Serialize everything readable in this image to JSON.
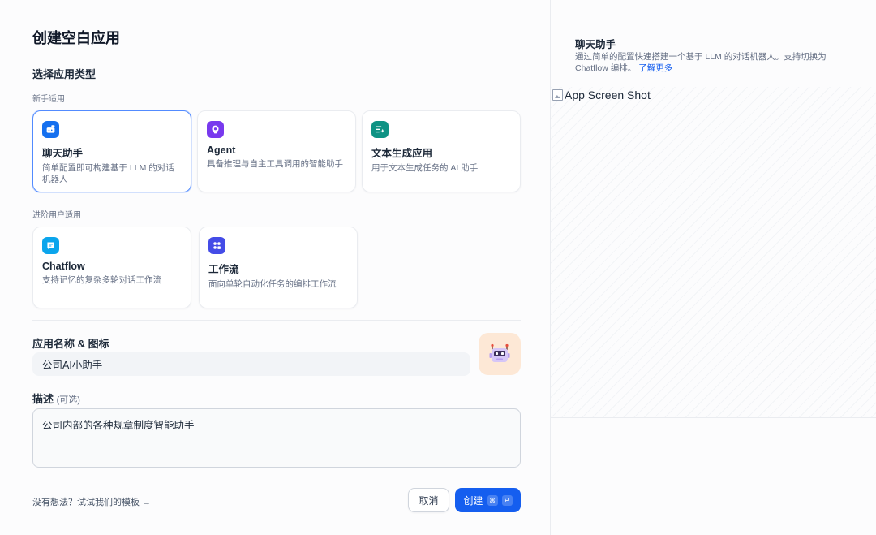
{
  "dialog": {
    "title": "创建空白应用",
    "type_section_label": "选择应用类型",
    "beginner_label": "新手适用",
    "advanced_label": "进阶用户适用"
  },
  "app_types": [
    {
      "title": "聊天助手",
      "desc": "简单配置即可构建基于 LLM 的对话机器人",
      "icon": "chat-bot-icon",
      "color": "#1570ef",
      "selected": true
    },
    {
      "title": "Agent",
      "desc": "具备推理与自主工具调用的智能助手",
      "icon": "agent-icon",
      "color": "#7839ee",
      "selected": false
    },
    {
      "title": "文本生成应用",
      "desc": "用于文本生成任务的 AI 助手",
      "icon": "text-generation-icon",
      "color": "#0e9384",
      "selected": false
    },
    {
      "title": "Chatflow",
      "desc": "支持记忆的复杂多轮对话工作流",
      "icon": "chatflow-icon",
      "color": "#0ba5ec",
      "selected": false
    },
    {
      "title": "工作流",
      "desc": "面向单轮自动化任务的编排工作流",
      "icon": "workflow-icon",
      "color": "#444ce7",
      "selected": false
    }
  ],
  "form": {
    "name_label": "应用名称 & 图标",
    "name_value": "公司AI小助手",
    "icon_bg": "#fde8d6",
    "desc_label": "描述",
    "desc_optional": "(可选)",
    "desc_value": "公司内部的各种规章制度智能助手"
  },
  "footer": {
    "template_link": "没有想法？试试我们的模板 →",
    "cancel_label": "取消",
    "create_label": "创建",
    "shortcut_cmd": "⌘",
    "shortcut_enter": "↵",
    "accent": "#155eef"
  },
  "preview": {
    "title": "聊天助手",
    "desc": "通过简单的配置快速搭建一个基于 LLM 的对话机器人。支持切换为 Chatflow 编排。",
    "learn_more": "了解更多",
    "image_alt": "App Screen Shot"
  }
}
